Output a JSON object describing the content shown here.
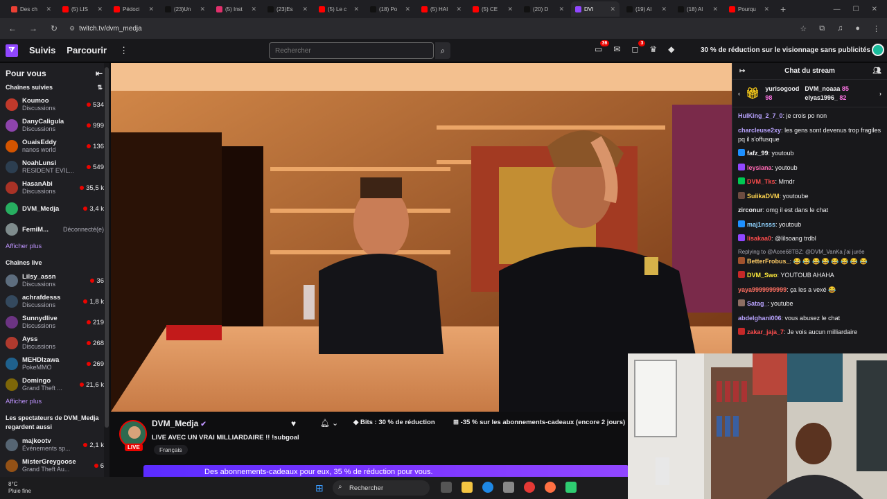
{
  "browser": {
    "tabs": [
      {
        "label": "Des ch",
        "color": "#eb4034",
        "active": false
      },
      {
        "label": "(5) LIS",
        "color": "#ff0000",
        "active": false
      },
      {
        "label": "Pédoci",
        "color": "#ff0000",
        "active": false
      },
      {
        "label": "(23)Un",
        "color": "#111111",
        "active": false
      },
      {
        "label": "(5) Inst",
        "color": "#e1306c",
        "active": false
      },
      {
        "label": "(23)Es",
        "color": "#111111",
        "active": false
      },
      {
        "label": "(5) Le c",
        "color": "#ff0000",
        "active": false
      },
      {
        "label": "(18) Po",
        "color": "#111111",
        "active": false
      },
      {
        "label": "(5) HAI",
        "color": "#ff0000",
        "active": false
      },
      {
        "label": "(5) CE",
        "color": "#ff0000",
        "active": false
      },
      {
        "label": "(20) D",
        "color": "#111111",
        "active": false
      },
      {
        "label": "DVI",
        "color": "#9147ff",
        "active": true
      },
      {
        "label": "(19) Al",
        "color": "#111111",
        "active": false
      },
      {
        "label": "(18) Al",
        "color": "#111111",
        "active": false
      },
      {
        "label": "Pourqu",
        "color": "#ff0000",
        "active": false
      }
    ],
    "url": "twitch.tv/dvm_medja"
  },
  "topnav": {
    "following": "Suivis",
    "browse": "Parcourir",
    "search_placeholder": "Rechercher",
    "notif_count": "36",
    "whisper_count": "3",
    "promo": "30 % de réduction sur le visionnage sans publicités"
  },
  "sidebar": {
    "title": "Pour vous",
    "followed_title": "Chaînes suivies",
    "followed": [
      {
        "name": "Koumoo",
        "category": "Discussions",
        "viewers": "534",
        "live": true,
        "color": "#c0392b"
      },
      {
        "name": "DanyCaligula",
        "category": "Discussions",
        "viewers": "999",
        "live": true,
        "color": "#8e44ad"
      },
      {
        "name": "OuaisEddy",
        "category": "nanos world",
        "viewers": "136",
        "live": true,
        "color": "#d35400"
      },
      {
        "name": "NoahLunsi",
        "category": "RESIDENT EVIL...",
        "viewers": "549",
        "live": true,
        "color": "#2c3e50"
      },
      {
        "name": "HasanAbi",
        "category": "Discussions",
        "viewers": "35,5 k",
        "live": true,
        "color": "#a93226"
      },
      {
        "name": "DVM_Medja",
        "category": "",
        "viewers": "3,4 k",
        "live": true,
        "color": "#27ae60"
      },
      {
        "name": "FemiM...",
        "category": "",
        "viewers": "Déconnecté(e)",
        "live": false,
        "color": "#7f8c8d"
      }
    ],
    "show_more": "Afficher plus",
    "live_title": "Chaînes live",
    "live_channels": [
      {
        "name": "Lilsy_assn",
        "category": "Discussions",
        "viewers": "36",
        "color": "#5d6d7e"
      },
      {
        "name": "achrafdesss",
        "category": "Discussions",
        "viewers": "1,8 k",
        "color": "#34495e"
      },
      {
        "name": "Sunnydlive",
        "category": "Discussions",
        "viewers": "219",
        "color": "#6c3483"
      },
      {
        "name": "Ayss",
        "category": "Discussions",
        "viewers": "268",
        "color": "#b03a2e"
      },
      {
        "name": "MEHDIzawa",
        "category": "PokeMMO",
        "viewers": "269",
        "color": "#1f618d"
      },
      {
        "name": "Domingo",
        "category": "Grand Theft ...",
        "viewers": "21,6 k",
        "color": "#7d6608"
      }
    ],
    "show_more_2": "Afficher plus",
    "also_title": "Les spectateurs de DVM_Medja regardent aussi",
    "also": [
      {
        "name": "majkootv",
        "category": "Événements sp...",
        "viewers": "2,1 k",
        "color": "#566573"
      },
      {
        "name": "MisterGreygoose",
        "category": "Grand Theft Au...",
        "viewers": "6",
        "color": "#935116"
      }
    ]
  },
  "stream": {
    "channel": "DVM_Medja",
    "title": "LIVE AVEC UN VRAI MILLIARDAIRE !! !subgoal",
    "language": "Français",
    "live_label": "LIVE",
    "bits": "Bits : 30 % de réduction",
    "subs": "-35 % sur les abonnements-cadeaux (encore 2 jours)",
    "gift_banner": "Des abonnements-cadeaux pour eux, 35 % de réduction pour vous."
  },
  "chat": {
    "title": "Chat du stream",
    "leaders": [
      {
        "name": "yurisogood",
        "points": "98"
      },
      {
        "name": "DVM_noaaa",
        "points": "85"
      },
      {
        "name": "elyas1996_",
        "points": "82"
      }
    ],
    "messages": [
      {
        "user": "HulKing_2_7_0",
        "color": "#b9a3ff",
        "text": "je crois po non",
        "badge": ""
      },
      {
        "user": "charcleuse2xy",
        "color": "#b9a3ff",
        "text": "les gens sont devenus trop fragiles pq il s'offusque",
        "badge": ""
      },
      {
        "user": "fafz_99",
        "color": "#efeff1",
        "text": "youtoub",
        "badge": "#1e90ff"
      },
      {
        "user": "leysiana",
        "color": "#ff69b4",
        "text": "youtoub",
        "badge": "#9147ff"
      },
      {
        "user": "DVM_Tks",
        "color": "#ff4d4d",
        "text": "Mmdr",
        "badge": "#00c853"
      },
      {
        "user": "SuiikaDVM",
        "color": "#ffd54f",
        "text": "youtoube",
        "badge": "#6d4c41"
      },
      {
        "user": "zirconur",
        "color": "#efeff1",
        "text": "omg il est dans le chat",
        "badge": ""
      },
      {
        "user": "maj1nsss",
        "color": "#8fd3ff",
        "text": "youtoub",
        "badge": "#1e90ff"
      },
      {
        "user": "lisakaa0",
        "color": "#ff4d4d",
        "text": "@lilsoang trdbl",
        "badge": "#9147ff"
      },
      {
        "user": "BetterFrobus_",
        "color": "#ffcc66",
        "text": "😂 😂 😂 😂 😂 😂 😂 😂",
        "badge": "#a0522d",
        "reply": "Replying to @Acee68TBZ: @DVM_VanKa j'ai jurée"
      },
      {
        "user": "DVM_Swo",
        "color": "#ffeb3b",
        "text": "YOUTOUB AHAHA",
        "badge": "#c62828"
      },
      {
        "user": "yaya9999999999",
        "color": "#ff6f61",
        "text": "ça les a vexé 😂",
        "badge": ""
      },
      {
        "user": "Satag_",
        "color": "#b9a3ff",
        "text": "youtube",
        "badge": "#8d6e63"
      },
      {
        "user": "abdelghani006",
        "color": "#b9a3ff",
        "text": "vous abusez le chat",
        "badge": ""
      },
      {
        "user": "zakar_jaja_7",
        "color": "#ff4d4d",
        "text": "Je vois aucun milliardaire",
        "badge": "#c62828"
      }
    ]
  },
  "taskbar": {
    "temp": "8°C",
    "weather": "Pluie fine",
    "search": "Rechercher"
  },
  "colors": {
    "twitch_purple": "#9147ff",
    "live_red": "#eb0400"
  }
}
